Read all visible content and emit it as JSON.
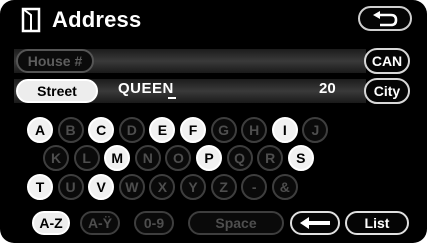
{
  "header": {
    "title": "Address",
    "icon": "map-book-icon",
    "back_icon": "return-arrow-icon"
  },
  "fields": {
    "house_label": "House #",
    "street_label": "Street",
    "street_value": "QUEEN",
    "street_count": "20",
    "can_label": "CAN",
    "city_label": "City"
  },
  "keyboard": {
    "row1": [
      {
        "label": "A",
        "active": true
      },
      {
        "label": "B",
        "active": false
      },
      {
        "label": "C",
        "active": true
      },
      {
        "label": "D",
        "active": false
      },
      {
        "label": "E",
        "active": true
      },
      {
        "label": "F",
        "active": true
      },
      {
        "label": "G",
        "active": false
      },
      {
        "label": "H",
        "active": false
      },
      {
        "label": "I",
        "active": true
      },
      {
        "label": "J",
        "active": false
      }
    ],
    "row2": [
      {
        "label": "K",
        "active": false
      },
      {
        "label": "L",
        "active": false
      },
      {
        "label": "M",
        "active": true
      },
      {
        "label": "N",
        "active": false
      },
      {
        "label": "O",
        "active": false
      },
      {
        "label": "P",
        "active": true
      },
      {
        "label": "Q",
        "active": false
      },
      {
        "label": "R",
        "active": false
      },
      {
        "label": "S",
        "active": true
      }
    ],
    "row3": [
      {
        "label": "T",
        "active": true
      },
      {
        "label": "U",
        "active": false
      },
      {
        "label": "V",
        "active": true
      },
      {
        "label": "W",
        "active": false
      },
      {
        "label": "X",
        "active": false
      },
      {
        "label": "Y",
        "active": false
      },
      {
        "label": "Z",
        "active": false
      },
      {
        "label": "-",
        "active": false
      },
      {
        "label": "&",
        "active": false
      }
    ]
  },
  "bottom": {
    "az_label": "A-Z",
    "ay_label": "A-Ÿ",
    "num_label": "0-9",
    "space_label": "Space",
    "backspace_icon": "left-arrow-icon",
    "list_label": "List"
  },
  "colors": {
    "background": "#000000",
    "active_key": "#f1f1f1",
    "inactive_key_text": "#4e4e4e"
  }
}
